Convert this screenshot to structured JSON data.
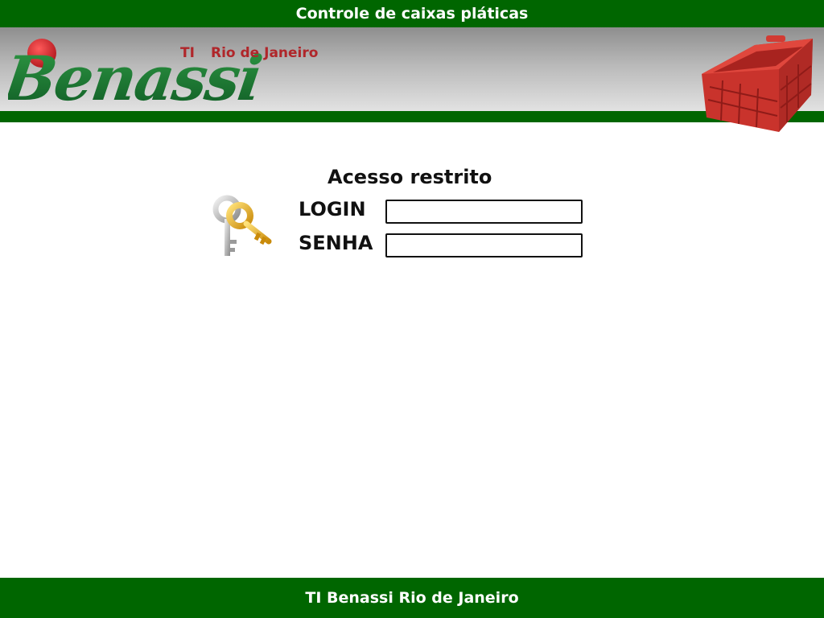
{
  "header": {
    "title": "Controle de caixas pláticas",
    "bar_color": "#006600"
  },
  "logo": {
    "brand": "Benassi",
    "sub_ti": "TI",
    "sub_city": "Rio de Janeiro",
    "brand_color": "#1a7a2e",
    "dot_color": "#c8202a"
  },
  "banner": {
    "image": "red-plastic-crate-icon"
  },
  "login": {
    "title": "Acesso restrito",
    "login_label": "LOGIN",
    "login_value": "",
    "senha_label": "SENHA",
    "senha_value": "",
    "icon": "keys-icon"
  },
  "footer": {
    "text": "TI Benassi Rio de Janeiro"
  }
}
